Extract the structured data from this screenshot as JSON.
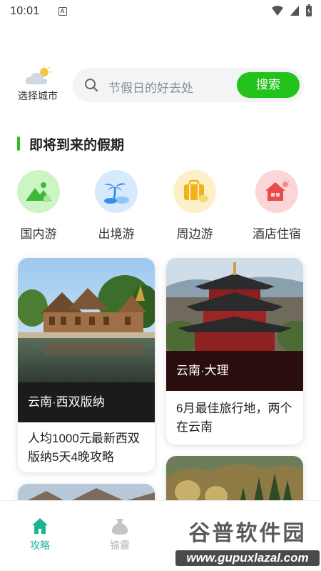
{
  "status_bar": {
    "time": "10:01"
  },
  "header": {
    "city_label": "选择城市",
    "search_placeholder": "节假日的好去处",
    "search_button": "搜索"
  },
  "section": {
    "title": "即将到来的假期"
  },
  "categories": [
    {
      "label": "国内游",
      "icon": "mountain-icon",
      "bg": "#cdf5c4"
    },
    {
      "label": "出境游",
      "icon": "palm-island-icon",
      "bg": "#d7eafc"
    },
    {
      "label": "周边游",
      "icon": "suitcase-icon",
      "bg": "#fdf0c9"
    },
    {
      "label": "酒店住宿",
      "icon": "house-icon",
      "bg": "#fcd6d6"
    }
  ],
  "cards": [
    {
      "tag": "云南·西双版纳",
      "text": "人均1000元最新西双版纳5天4晚攻略"
    },
    {
      "tag": "云南·大理",
      "text": "6月最佳旅行地，两个在云南"
    }
  ],
  "bottom_nav": [
    {
      "label": "攻略",
      "icon": "home-icon",
      "active": true
    },
    {
      "label": "锦囊",
      "icon": "bag-icon",
      "active": false
    }
  ],
  "colors": {
    "accent": "#22c31a",
    "nav_active": "#1fb394",
    "nav_inactive": "#b8b8b8"
  },
  "watermark": {
    "main": "谷普软件园",
    "url": "www.gupuxlazal.com"
  }
}
